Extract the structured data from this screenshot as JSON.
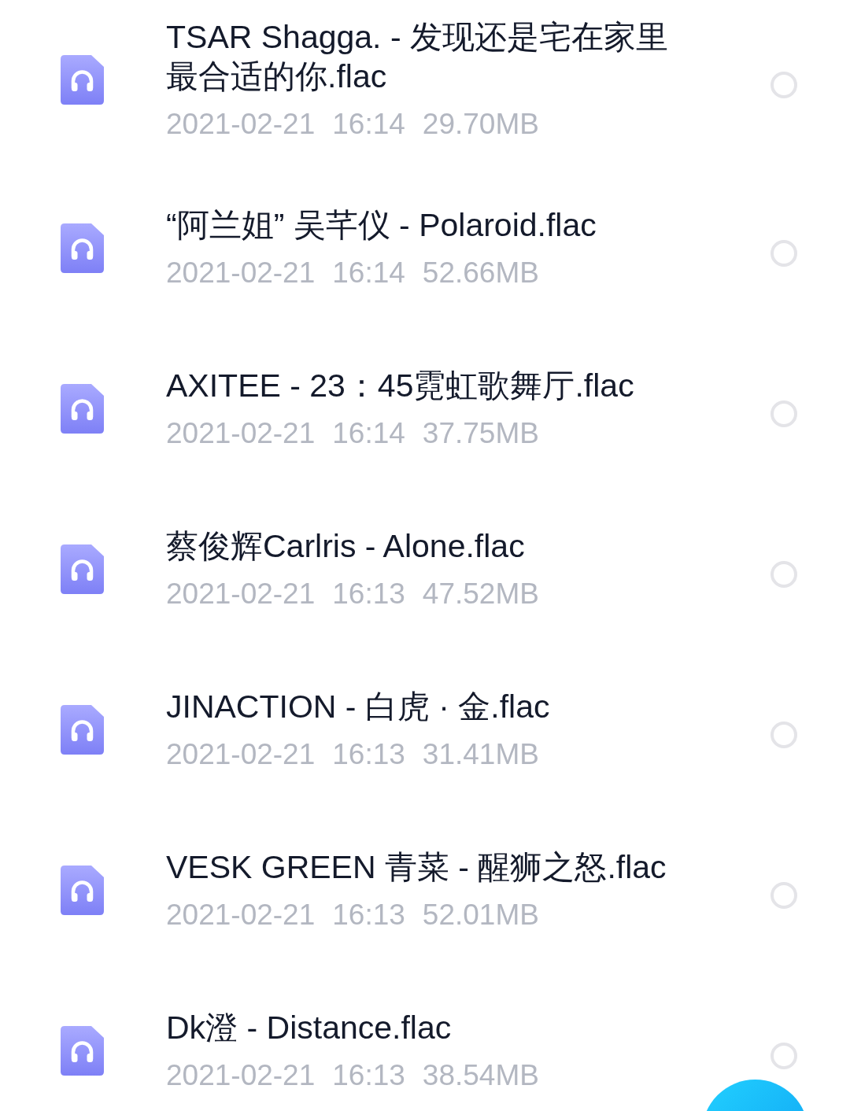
{
  "files": [
    {
      "name": "TSAR Shagga. - 发现还是宅在家里最合适的你.flac",
      "date": "2021-02-21",
      "time": "16:14",
      "size": "29.70MB",
      "selected": false
    },
    {
      "name": "“阿兰姐” 吴芊仪 - Polaroid.flac",
      "date": "2021-02-21",
      "time": "16:14",
      "size": "52.66MB",
      "selected": false
    },
    {
      "name": "AXITEE - 23：45霓虹歌舞厅.flac",
      "date": "2021-02-21",
      "time": "16:14",
      "size": "37.75MB",
      "selected": false
    },
    {
      "name": "蔡俊辉Carlris - Alone.flac",
      "date": "2021-02-21",
      "time": "16:13",
      "size": "47.52MB",
      "selected": false
    },
    {
      "name": "JINACTION - 白虎 · 金.flac",
      "date": "2021-02-21",
      "time": "16:13",
      "size": "31.41MB",
      "selected": false
    },
    {
      "name": "VESK GREEN 青菜 - 醒狮之怒.flac",
      "date": "2021-02-21",
      "time": "16:13",
      "size": "52.01MB",
      "selected": false
    },
    {
      "name": "Dk澄 - Distance.flac",
      "date": "2021-02-21",
      "time": "16:13",
      "size": "38.54MB",
      "selected": false
    }
  ]
}
